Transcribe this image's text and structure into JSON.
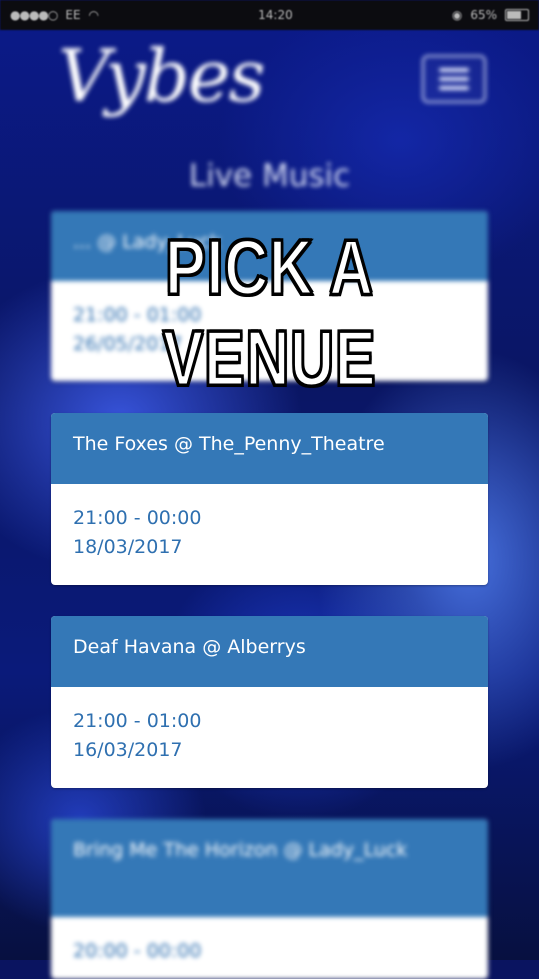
{
  "status_bar": {
    "carrier": "EE",
    "time": "14:20",
    "battery": "65%"
  },
  "header": {
    "logo": "Vybes",
    "subtitle": "Live Music"
  },
  "overlay": {
    "title": "PICK A VENUE"
  },
  "events": [
    {
      "title": "... @ Lady_Luck",
      "time": "21:00 - 01:00",
      "date": "26/05/2017"
    },
    {
      "title": "The Foxes @ The_Penny_Theatre",
      "time": "21:00 - 00:00",
      "date": "18/03/2017"
    },
    {
      "title": "Deaf Havana @ Alberrys",
      "time": "21:00 - 01:00",
      "date": "16/03/2017"
    },
    {
      "title": "Bring Me The Horizon @ Lady_Luck",
      "time": "20:00 - 00:00",
      "date": ""
    }
  ]
}
